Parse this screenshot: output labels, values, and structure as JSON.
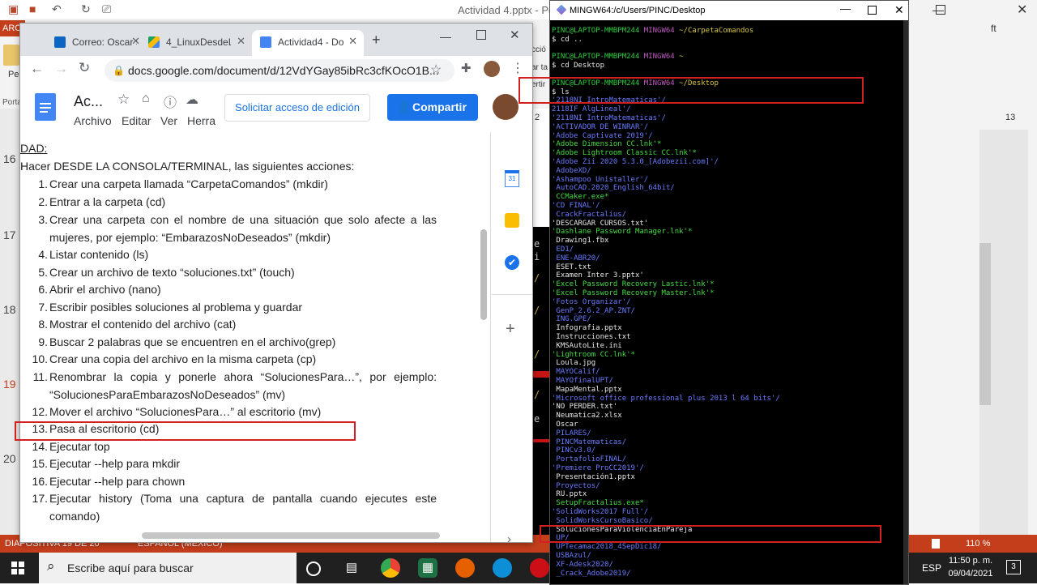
{
  "powerpoint": {
    "title": "Actividad 4.pptx - Pow",
    "tab_left": "ARC",
    "slide_numbers": [
      "16",
      "17",
      "18",
      "19",
      "20"
    ],
    "status_slide": "DIAPOSITIVA 19 DE 20",
    "status_lang": "ESPAÑOL (MÉXICO)",
    "zoom": "110 %",
    "left_labels": [
      "Pe",
      "Porta"
    ],
    "right_labels": [
      "ft"
    ],
    "behind_labels": [
      "cció",
      "ar ta",
      "ertir"
    ],
    "ruler_nums": [
      "2",
      "13"
    ]
  },
  "taskbar": {
    "search_placeholder": "Escribe aquí para buscar",
    "language": "ESP",
    "time": "11:50 p. m.",
    "date": "09/04/2021",
    "notifications": "3"
  },
  "chrome": {
    "tabs": [
      {
        "label": "Correo: Oscar S",
        "color": "#0a66c2"
      },
      {
        "label": "4_LinuxDesdeLa",
        "color": "#1aa260"
      },
      {
        "label": "Actividad4 - Do",
        "color": "#4285f4"
      }
    ],
    "url": "docs.google.com/document/d/12VdYGay85ibRc3cfKOcO1B..."
  },
  "docs": {
    "title": "Ac...",
    "menus": [
      "Archivo",
      "Editar",
      "Ver",
      "Herra"
    ],
    "request_button": "Solicitar acceso de edición",
    "share_button": "Compartir",
    "heading": "DAD:",
    "intro": "Hacer DESDE LA CONSOLA/TERMINAL, las siguientes acciones:",
    "side_calendar": "31",
    "items": [
      {
        "n": "1.",
        "text": "Crear una carpeta llamada “CarpetaComandos” (mkdir)"
      },
      {
        "n": "2.",
        "text": "Entrar a la carpeta (cd)"
      },
      {
        "n": "3.",
        "text": "Crear una carpeta con el nombre de una situación que solo afecte a las mujeres, por ejemplo: “EmbarazosNoDeseados” (mkdir)"
      },
      {
        "n": "4.",
        "text": "Listar contenido (ls)"
      },
      {
        "n": "5.",
        "text": "Crear un archivo de texto “soluciones.txt” (touch)"
      },
      {
        "n": "6.",
        "text": "Abrir el archivo (nano)"
      },
      {
        "n": "7.",
        "text": "Escribir posibles soluciones al problema y guardar"
      },
      {
        "n": "8.",
        "text": "Mostrar el contenido del archivo (cat)"
      },
      {
        "n": "9.",
        "text": "Buscar 2 palabras que se encuentren en el archivo(grep)"
      },
      {
        "n": "10.",
        "text": "Crear una copia del archivo en la misma carpeta (cp)"
      },
      {
        "n": "11.",
        "text": "Renombrar la copia y ponerle ahora “SolucionesPara…”, por ejemplo: “SolucionesParaEmbarazosNoDeseados” (mv)"
      },
      {
        "n": "12.",
        "text": "Mover el archivo “SolucionesPara…” al escritorio (mv)"
      },
      {
        "n": "13.",
        "text": "Pasa al escritorio (cd)"
      },
      {
        "n": "14.",
        "text": "Ejecutar top"
      },
      {
        "n": "15.",
        "text": "Ejecutar --help para mkdir"
      },
      {
        "n": "16.",
        "text": "Ejecutar --help para chown"
      },
      {
        "n": "17.",
        "text": "Ejecutar history (Toma una captura de pantalla cuando ejecutes este comando)"
      }
    ]
  },
  "terminal": {
    "title": "MINGW64:/c/Users/PINC/Desktop",
    "lines": [
      {
        "parts": [
          [
            "PINC@LAPTOP-MMBPM244 ",
            "pg"
          ],
          [
            "MINGW64 ",
            "pp"
          ],
          [
            "~/CarpetaComandos",
            "py"
          ]
        ]
      },
      {
        "parts": [
          [
            "$ cd ..",
            "cw"
          ]
        ]
      },
      {
        "parts": [
          [
            "",
            "cw"
          ]
        ]
      },
      {
        "parts": [
          [
            "PINC@LAPTOP-MMBPM244 ",
            "pg"
          ],
          [
            "MINGW64 ",
            "pp"
          ],
          [
            "~",
            "py"
          ]
        ]
      },
      {
        "parts": [
          [
            "$ cd Desktop",
            "cw"
          ]
        ]
      },
      {
        "parts": [
          [
            "",
            "cw"
          ]
        ]
      },
      {
        "parts": [
          [
            "PINC@LAPTOP-MMBPM244 ",
            "pg"
          ],
          [
            "MINGW64 ",
            "pp"
          ],
          [
            "~/Desktop",
            "py"
          ]
        ]
      },
      {
        "parts": [
          [
            "$ ls",
            "cw"
          ]
        ]
      },
      {
        "parts": [
          [
            "'2118NI IntroMatematicas'/",
            "cb"
          ]
        ]
      },
      {
        "parts": [
          [
            "2118IF AlgLineal'/",
            "cb"
          ]
        ]
      },
      {
        "parts": [
          [
            "'2118NI IntroMatematicas'/",
            "cb"
          ]
        ]
      },
      {
        "parts": [
          [
            "'ACTIVADOR DE WINRAR'/",
            "cb"
          ]
        ]
      },
      {
        "parts": [
          [
            "'Adobe Captivate 2019'/",
            "cb"
          ]
        ]
      },
      {
        "parts": [
          [
            "'Adobe Dimension CC.lnk'*",
            "cgr"
          ]
        ]
      },
      {
        "parts": [
          [
            "'Adobe Lightroom Classic CC.lnk'*",
            "cgr"
          ]
        ]
      },
      {
        "parts": [
          [
            "'Adobe Zii 2020 5.3.0_[Adobezii.com]'/",
            "cb"
          ]
        ]
      },
      {
        "parts": [
          [
            " AdobeXD/",
            "cb"
          ]
        ]
      },
      {
        "parts": [
          [
            "'Ashampoo Unistaller'/",
            "cb"
          ]
        ]
      },
      {
        "parts": [
          [
            " AutoCAD.2020_English_64bit/",
            "cb"
          ]
        ]
      },
      {
        "parts": [
          [
            " CCMaker.exe*",
            "cgr"
          ]
        ]
      },
      {
        "parts": [
          [
            "'CD FINAL'/",
            "cb"
          ]
        ]
      },
      {
        "parts": [
          [
            " CrackFractalius/",
            "cb"
          ]
        ]
      },
      {
        "parts": [
          [
            "'DESCARGAR CURSOS.txt'",
            "cw"
          ]
        ]
      },
      {
        "parts": [
          [
            "'Dashlane Password Manager.lnk'*",
            "cgr"
          ]
        ]
      },
      {
        "parts": [
          [
            " Drawing1.fbx",
            "cw"
          ]
        ]
      },
      {
        "parts": [
          [
            " ED1/",
            "cb"
          ]
        ]
      },
      {
        "parts": [
          [
            " ENE-ABR20/",
            "cb"
          ]
        ]
      },
      {
        "parts": [
          [
            " ESET.txt",
            "cw"
          ]
        ]
      },
      {
        "parts": [
          [
            " Examen Inter 3.pptx'",
            "cw"
          ]
        ]
      },
      {
        "parts": [
          [
            "'Excel Password Recovery Lastic.lnk'*",
            "cgr"
          ]
        ]
      },
      {
        "parts": [
          [
            "'Excel Password Recovery Master.lnk'*",
            "cgr"
          ]
        ]
      },
      {
        "parts": [
          [
            "'Fotos Organizar'/",
            "cb"
          ]
        ]
      },
      {
        "parts": [
          [
            " GenP_2.6.2_AP.ZNT/",
            "cb"
          ]
        ]
      },
      {
        "parts": [
          [
            " ING.GPE/",
            "cb"
          ]
        ]
      },
      {
        "parts": [
          [
            " Infografia.pptx",
            "cw"
          ]
        ]
      },
      {
        "parts": [
          [
            " Instrucciones.txt",
            "cw"
          ]
        ]
      },
      {
        "parts": [
          [
            " KMSAutoLite.ini",
            "cw"
          ]
        ]
      },
      {
        "parts": [
          [
            "'Lightroom CC.lnk'*",
            "cgr"
          ]
        ]
      },
      {
        "parts": [
          [
            " Loula.jpg",
            "cw"
          ]
        ]
      },
      {
        "parts": [
          [
            " MAYOCalif/",
            "cb"
          ]
        ]
      },
      {
        "parts": [
          [
            " MAYOfinalUPT/",
            "cb"
          ]
        ]
      },
      {
        "parts": [
          [
            " MapaMental.pptx",
            "cw"
          ]
        ]
      },
      {
        "parts": [
          [
            "'Microsoft office professional plus 2013 l 64 bits'/",
            "cb"
          ]
        ]
      },
      {
        "parts": [
          [
            "'NO PERDER.txt'",
            "cw"
          ]
        ]
      },
      {
        "parts": [
          [
            " Neumatica2.xlsx",
            "cw"
          ]
        ]
      },
      {
        "parts": [
          [
            " Oscar",
            "cw"
          ]
        ]
      },
      {
        "parts": [
          [
            " PILARES/",
            "cb"
          ]
        ]
      },
      {
        "parts": [
          [
            " PINCMatematicas/",
            "cb"
          ]
        ]
      },
      {
        "parts": [
          [
            " PINCv3.0/",
            "cb"
          ]
        ]
      },
      {
        "parts": [
          [
            " PortafolioFINAL/",
            "cb"
          ]
        ]
      },
      {
        "parts": [
          [
            "'Premiere ProCC2019'/",
            "cb"
          ]
        ]
      },
      {
        "parts": [
          [
            " Presentación1.pptx",
            "cw"
          ]
        ]
      },
      {
        "parts": [
          [
            " Proyectos/",
            "cb"
          ]
        ]
      },
      {
        "parts": [
          [
            " RU.pptx",
            "cw"
          ]
        ]
      },
      {
        "parts": [
          [
            " SetupFractalius.exe*",
            "cgr"
          ]
        ]
      },
      {
        "parts": [
          [
            "'SolidWorks2017 Full'/",
            "cb"
          ]
        ]
      },
      {
        "parts": [
          [
            " SolidWorksCursoBasico/",
            "cb"
          ]
        ]
      },
      {
        "parts": [
          [
            " SolucionesParaViolenciaEnPareja",
            "cw"
          ]
        ]
      },
      {
        "parts": [
          [
            " UP/",
            "cb"
          ]
        ]
      },
      {
        "parts": [
          [
            " UPTecamac2018_4SepDic18/",
            "cb"
          ]
        ]
      },
      {
        "parts": [
          [
            " USBAzul/",
            "cb"
          ]
        ]
      },
      {
        "parts": [
          [
            " XF-Adesk2020/",
            "cb"
          ]
        ]
      },
      {
        "parts": [
          [
            " _Crack_Adobe2019/",
            "cb"
          ]
        ]
      }
    ]
  }
}
